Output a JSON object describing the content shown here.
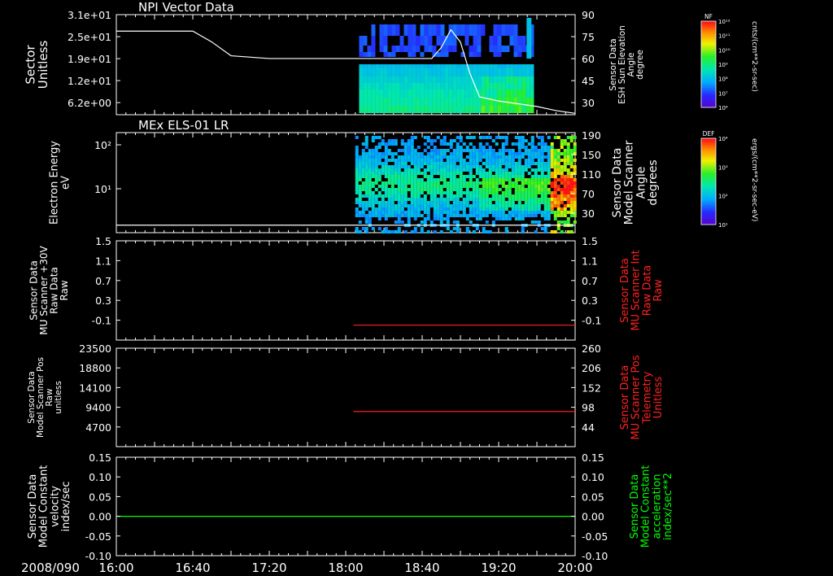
{
  "colors": {
    "background": "#000000",
    "axis": "#ffffff",
    "red": "#ff2020",
    "green": "#00ff00"
  },
  "time_axis": {
    "date_label": "2008/090",
    "ticks": [
      "16:00",
      "16:40",
      "17:20",
      "18:00",
      "18:40",
      "19:20",
      "20:00"
    ],
    "range_minutes": [
      0,
      240
    ]
  },
  "chart_data": [
    {
      "type": "heatmap",
      "title": "NPI Vector Data",
      "ylabel": [
        "Sector",
        "Unitless"
      ],
      "yticks": [
        "3.1e+01",
        "2.5e+01",
        "1.9e+01",
        "1.2e+01",
        "6.2e+00"
      ],
      "right_label": [
        "Sensor Data",
        "ESH Sun Elevation",
        "Angle",
        "degree"
      ],
      "right_ticks": [
        "90",
        "75",
        "60",
        "45",
        "30"
      ],
      "right_range": [
        17,
        90
      ],
      "overlay_line": {
        "x_min": [
          0,
          40,
          50,
          60,
          80,
          165,
          170,
          175,
          180,
          185,
          190,
          200,
          210,
          220,
          230,
          240
        ],
        "y_deg": [
          78,
          78,
          70,
          60,
          58,
          58,
          66,
          79,
          70,
          47,
          30,
          27,
          25,
          23,
          20,
          18
        ]
      },
      "data_start": "18:07",
      "data_end": "19:38",
      "colorbar": {
        "label": "NF",
        "units": "cnts/(cm**2-sr-sec)",
        "ticks": [
          "10¹²",
          "10¹¹",
          "10¹⁰",
          "10⁹",
          "10⁸",
          "10⁷",
          "10⁶"
        ]
      }
    },
    {
      "type": "heatmap",
      "title": "MEx ELS-01 LR",
      "ylabel": [
        "Electron Energy",
        "eV"
      ],
      "yticks": [
        "10²",
        "10¹"
      ],
      "right_label": [
        "Sensor Data",
        "Model Scanner",
        "Angle",
        "degrees"
      ],
      "right_ticks": [
        "190",
        "150",
        "110",
        "70",
        "30"
      ],
      "right_range": [
        0,
        190
      ],
      "overlay_line": {
        "x_min": [
          0,
          240
        ],
        "y_deg": [
          5,
          5
        ]
      },
      "data_start": "18:05",
      "data_end": "20:00",
      "colorbar": {
        "label": "DEF",
        "units": "ergs/(cm**2-sr-sec-eV)",
        "ticks": [
          "10⁴",
          "10³",
          "10²",
          "10¹"
        ]
      }
    },
    {
      "type": "line",
      "ylabel": [
        "Sensor Data",
        "MU Scanner +30V",
        "Raw Data",
        "Raw"
      ],
      "yticks": [
        "1.5",
        "1.1",
        "0.7",
        "0.3",
        "-0.1"
      ],
      "ylim": [
        -0.3,
        1.5
      ],
      "right_label": [
        "Sensor Data",
        "MU Scanner Int",
        "Raw Data",
        "Raw"
      ],
      "right_ticks": [
        "1.5",
        "1.1",
        "0.7",
        "0.3",
        "-0.1"
      ],
      "series": [
        {
          "x_min": [
            124,
            240
          ],
          "y": [
            -0.03,
            -0.03
          ]
        }
      ]
    },
    {
      "type": "line",
      "ylabel": [
        "Sensor Data",
        "Model Scanner Pos",
        "Raw",
        "unitless"
      ],
      "yticks": [
        "23500",
        "18800",
        "14100",
        "9400",
        "4700"
      ],
      "ylim": [
        0,
        23500
      ],
      "right_label": [
        "Sensor Data",
        "MU Scanner Pos",
        "Telemetry",
        "Unitless"
      ],
      "right_ticks": [
        "260",
        "206",
        "152",
        "98",
        "44"
      ],
      "series": [
        {
          "x_min": [
            124,
            240
          ],
          "y": [
            8400,
            8400
          ]
        }
      ]
    },
    {
      "type": "line",
      "ylabel": [
        "Sensor Data",
        "Model Constant",
        "velocity",
        "index/sec"
      ],
      "yticks": [
        "0.15",
        "0.10",
        "0.05",
        "0.00",
        "-0.05",
        "-0.10"
      ],
      "ylim": [
        -0.1,
        0.15
      ],
      "right_label": [
        "Sensor Data",
        "Model Constant",
        "acceleration",
        "index/sec**2"
      ],
      "right_ticks": [
        "0.15",
        "0.10",
        "0.05",
        "0.00",
        "-0.05",
        "-0.10"
      ],
      "series": [
        {
          "x_min": [
            0,
            240
          ],
          "y": [
            0.0,
            0.0
          ]
        }
      ]
    }
  ]
}
